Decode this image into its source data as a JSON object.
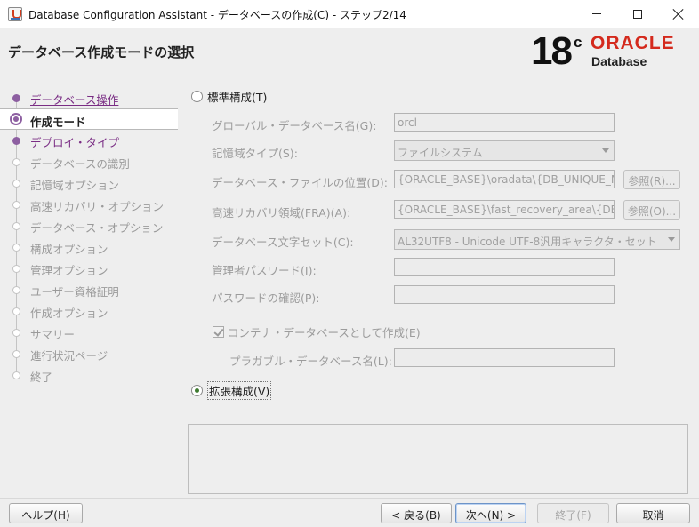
{
  "window": {
    "title": "Database Configuration Assistant - データベースの作成(C) - ステップ2/14"
  },
  "header": {
    "title": "データベース作成モードの選択",
    "brand_version": "18",
    "brand_version_sup": "c",
    "brand_name": "ORACLE",
    "brand_product": "Database",
    "brand_color": "#d42a1d"
  },
  "nav": {
    "items": [
      {
        "label": "データベース操作",
        "state": "visited"
      },
      {
        "label": "作成モード",
        "state": "current"
      },
      {
        "label": "デプロイ・タイプ",
        "state": "visited"
      },
      {
        "label": "データベースの識別",
        "state": "pending"
      },
      {
        "label": "記憶域オプション",
        "state": "pending"
      },
      {
        "label": "高速リカバリ・オプション",
        "state": "pending"
      },
      {
        "label": "データベース・オプション",
        "state": "pending"
      },
      {
        "label": "構成オプション",
        "state": "pending"
      },
      {
        "label": "管理オプション",
        "state": "pending"
      },
      {
        "label": "ユーザー資格証明",
        "state": "pending"
      },
      {
        "label": "作成オプション",
        "state": "pending"
      },
      {
        "label": "サマリー",
        "state": "pending"
      },
      {
        "label": "進行状況ページ",
        "state": "pending"
      },
      {
        "label": "終了",
        "state": "pending"
      }
    ]
  },
  "form": {
    "typical": {
      "label": "標準構成(T)",
      "selected": false
    },
    "global_db_name": {
      "label": "グローバル・データベース名(G):",
      "value": "orcl"
    },
    "storage_type": {
      "label": "記憶域タイプ(S):",
      "value": "ファイルシステム"
    },
    "db_file_location": {
      "label": "データベース・ファイルの位置(D):",
      "value": "{ORACLE_BASE}\\oradata\\{DB_UNIQUE_NAME}",
      "browse_label": "参照(R)..."
    },
    "fra": {
      "label": "高速リカバリ領域(FRA)(A):",
      "value": "{ORACLE_BASE}\\fast_recovery_area\\{DB_UNIQUE_NAME}",
      "browse_label": "参照(O)..."
    },
    "charset": {
      "label": "データベース文字セット(C):",
      "value": "AL32UTF8 - Unicode UTF-8汎用キャラクタ・セット"
    },
    "admin_password": {
      "label": "管理者パスワード(I):",
      "value": ""
    },
    "confirm_password": {
      "label": "パスワードの確認(P):",
      "value": ""
    },
    "container_db": {
      "label": "コンテナ・データベースとして作成(E)",
      "checked": true
    },
    "pdb_name": {
      "label": "プラガブル・データベース名(L):",
      "value": ""
    },
    "advanced": {
      "label": "拡張構成(V)",
      "selected": true
    }
  },
  "footer": {
    "help": "ヘルプ(H)",
    "back": "< 戻る(B)",
    "next": "次へ(N) >",
    "finish": "終了(F)",
    "cancel": "取消"
  }
}
